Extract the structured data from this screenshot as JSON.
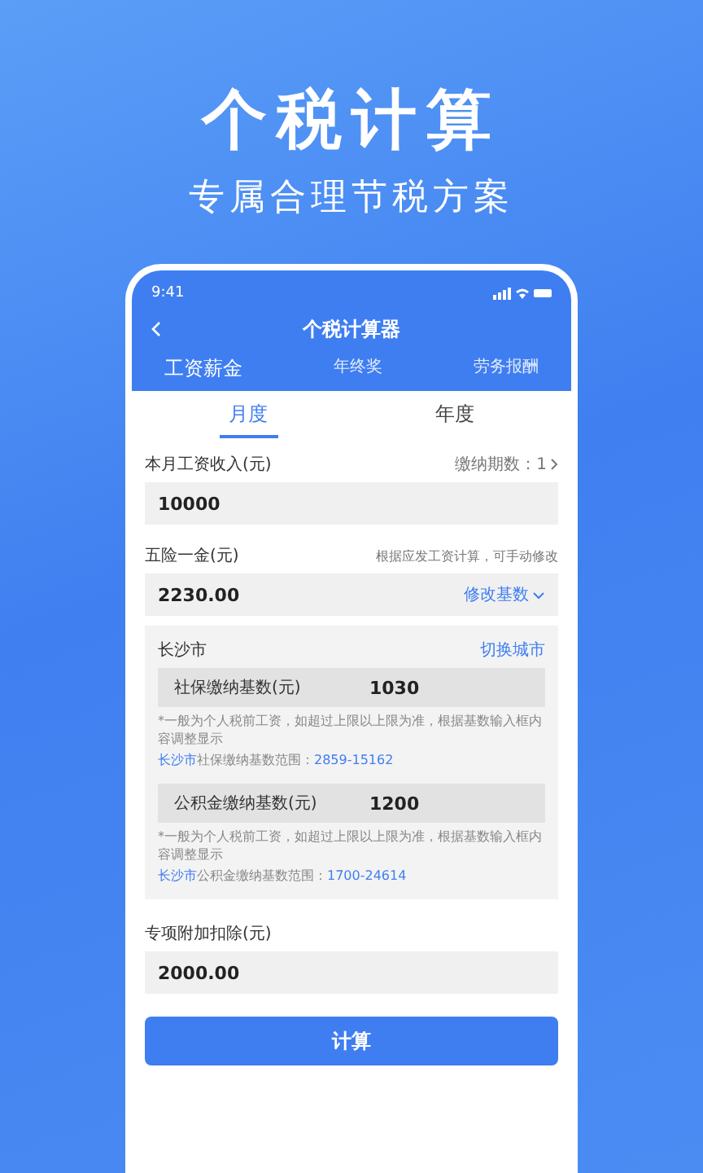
{
  "headline": "个税计算",
  "subtitle": "专属合理节税方案",
  "status": {
    "time": "9:41"
  },
  "nav": {
    "title": "个税计算器"
  },
  "tabs": [
    {
      "label": "工资薪金",
      "selected": true
    },
    {
      "label": "年终奖",
      "selected": false
    },
    {
      "label": "劳务报酬",
      "selected": false
    }
  ],
  "periods": [
    {
      "label": "月度",
      "selected": true
    },
    {
      "label": "年度",
      "selected": false
    }
  ],
  "salary": {
    "label": "本月工资收入(元)",
    "aside": "缴纳期数：1",
    "value": "10000"
  },
  "insurance": {
    "label": "五险一金(元)",
    "hint": "根据应发工资计算，可手动修改",
    "value": "2230.00",
    "action": "修改基数"
  },
  "city_panel": {
    "city": "长沙市",
    "switch": "切换城市",
    "bases": [
      {
        "label": "社保缴纳基数(元)",
        "value": "1030",
        "note": "*一般为个人税前工资，如超过上限以上限为准，根据基数输入框内容调整显示",
        "range_city": "长沙市",
        "range_label": "社保缴纳基数范围：",
        "range_value": "2859-15162"
      },
      {
        "label": "公积金缴纳基数(元)",
        "value": "1200",
        "note": "*一般为个人税前工资，如超过上限以上限为准，根据基数输入框内容调整显示",
        "range_city": "长沙市",
        "range_label": "公积金缴纳基数范围：",
        "range_value": "1700-24614"
      }
    ]
  },
  "deduction": {
    "label": "专项附加扣除(元)",
    "value": "2000.00"
  },
  "button": "计算"
}
